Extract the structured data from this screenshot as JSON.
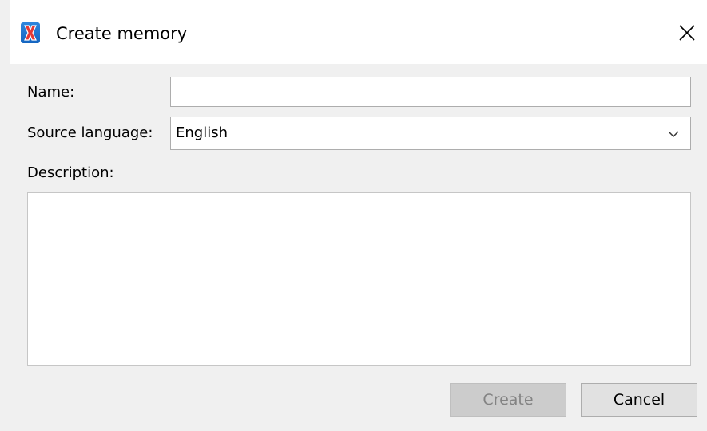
{
  "window": {
    "title": "Create memory",
    "app_icon": "x-app-icon",
    "close_icon": "close-icon"
  },
  "form": {
    "name_label": "Name:",
    "name_value": "",
    "source_language_label": "Source language:",
    "source_language_value": "English",
    "description_label": "Description:",
    "description_value": ""
  },
  "buttons": {
    "create_label": "Create",
    "create_enabled": false,
    "cancel_label": "Cancel"
  },
  "colors": {
    "icon_blue": "#1e6fd0",
    "icon_x_red": "#e53935",
    "disabled_text": "#838383"
  }
}
